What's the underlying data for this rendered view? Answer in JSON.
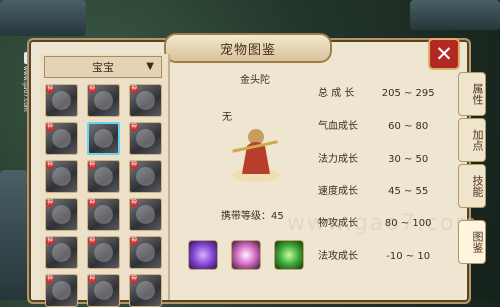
{
  "title": "宠物图鉴",
  "dropdown": {
    "label": "宝宝"
  },
  "pet": {
    "name": "金头陀",
    "wu": "无",
    "carry_level": "携带等级：45"
  },
  "stats": [
    {
      "label": "总 成 长",
      "value": "205 ~ 295"
    },
    {
      "label": "气血成长",
      "value": "60 ~ 80"
    },
    {
      "label": "法力成长",
      "value": "30 ~ 50"
    },
    {
      "label": "速度成长",
      "value": "45 ~ 55"
    },
    {
      "label": "物攻成长",
      "value": "80 ~ 100"
    },
    {
      "label": "法攻成长",
      "value": "-10 ~ 10"
    }
  ],
  "tabs": [
    "属性",
    "加点",
    "技能",
    "图鉴"
  ],
  "watermark": "www.gao7.com",
  "corner_url": "www.gao7.com",
  "colors": {
    "panel": "#efe6d1",
    "close": "#b22923",
    "accent": "#63d7ef"
  },
  "icons": {
    "close": "close-icon",
    "dropdown_arrow": "chevron-down-icon",
    "skills": [
      "swirl-skill-icon",
      "spike-skill-icon",
      "skull-skill-icon"
    ]
  },
  "grid_badge": "神"
}
